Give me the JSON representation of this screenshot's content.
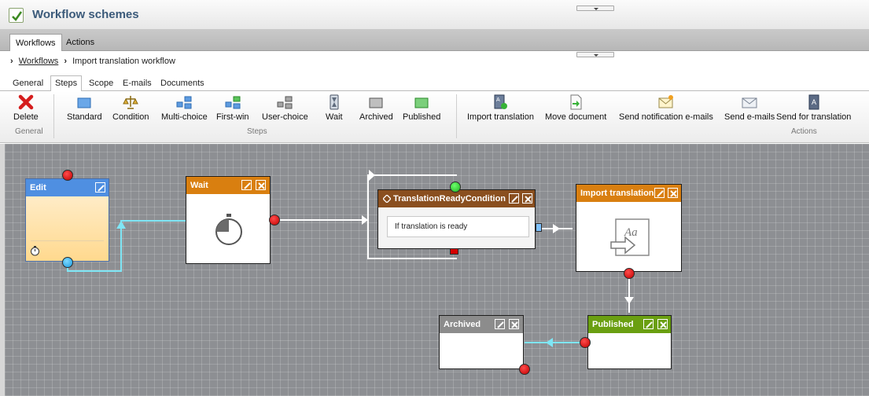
{
  "title": "Workflow schemes",
  "main_tabs": [
    {
      "label": "Workflows",
      "active": true
    },
    {
      "label": "Actions",
      "active": false
    }
  ],
  "breadcrumb": {
    "root": "Workflows",
    "current": "Import translation workflow"
  },
  "sub_tabs": [
    {
      "label": "General",
      "active": false
    },
    {
      "label": "Steps",
      "active": true
    },
    {
      "label": "Scope",
      "active": false
    },
    {
      "label": "E-mails",
      "active": false
    },
    {
      "label": "Documents",
      "active": false
    }
  ],
  "toolbar": {
    "general": {
      "group_label": "General",
      "delete_label": "Delete"
    },
    "steps": {
      "group_label": "Steps",
      "items": [
        "Standard",
        "Condition",
        "Multi-choice",
        "First-win",
        "User-choice",
        "Wait",
        "Archived",
        "Published"
      ]
    },
    "actions": {
      "group_label": "Actions",
      "items": [
        "Import translation",
        "Move document",
        "Send notification e-mails",
        "Send e-mails",
        "Send for translation"
      ]
    }
  },
  "nodes": {
    "edit": {
      "title": "Edit",
      "color": "#4f8fe1"
    },
    "wait": {
      "title": "Wait",
      "color": "#d97f10"
    },
    "condition": {
      "title": "TranslationReadyCondition",
      "case_label": "If translation is ready",
      "color": "#8a4f1f"
    },
    "import_translation": {
      "title": "Import translation",
      "color": "#d97f10"
    },
    "archived": {
      "title": "Archived",
      "color": "#8c8c8c"
    },
    "published": {
      "title": "Published",
      "color": "#6a9f11"
    }
  },
  "colors": {
    "canvas": "#8d8f93",
    "connector_cyan": "#7fe6f5",
    "connector_white": "#ffffff",
    "title_text": "#3b5a7a"
  }
}
